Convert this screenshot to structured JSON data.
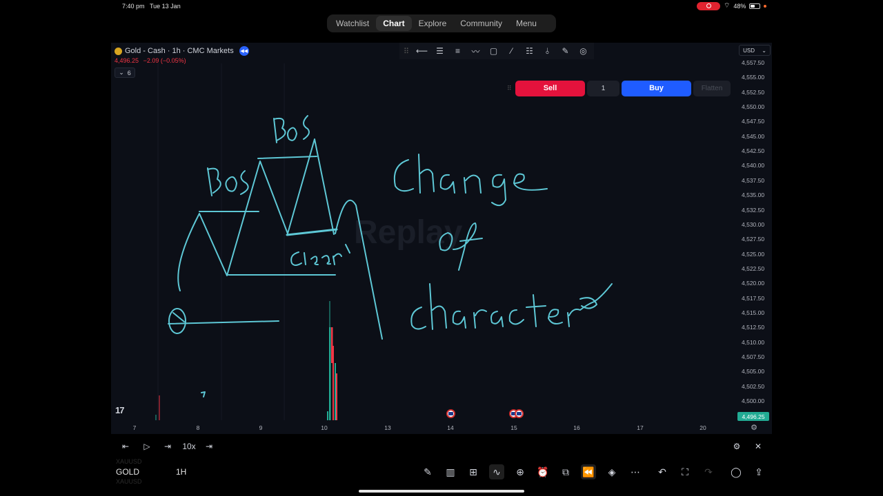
{
  "status_bar": {
    "time": "7:40 pm",
    "date": "Tue 13 Jan",
    "battery": "48%",
    "battery_level": 0.48
  },
  "top_tabs": [
    {
      "label": "Watchlist",
      "active": false
    },
    {
      "label": "Chart",
      "active": true
    },
    {
      "label": "Explore",
      "active": false
    },
    {
      "label": "Community",
      "active": false
    },
    {
      "label": "Menu",
      "active": false
    }
  ],
  "chart": {
    "symbol_title": "Gold - Cash · 1h · CMC Markets",
    "price": "4,496.25",
    "change": "−2.09 (−0.05%)",
    "indicators_count": "6",
    "currency": "USD",
    "watermark": "Replay",
    "current_price_label": "4,496.25",
    "price_ticks": [
      "4,557.50",
      "4,555.00",
      "4,552.50",
      "4,550.00",
      "4,547.50",
      "4,545.00",
      "4,542.50",
      "4,540.00",
      "4,537.50",
      "4,535.00",
      "4,532.50",
      "4,530.00",
      "4,527.50",
      "4,525.00",
      "4,522.50",
      "4,520.00",
      "4,517.50",
      "4,515.00",
      "4,512.50",
      "4,510.00",
      "4,507.50",
      "4,505.00",
      "4,502.50",
      "4,500.00"
    ],
    "time_ticks": [
      "7",
      "8",
      "9",
      "10",
      "13",
      "14",
      "15",
      "16",
      "17",
      "20"
    ],
    "colors": {
      "up": "#22ab94",
      "down": "#f23645",
      "ink": "#5ec8d6",
      "buy": "#1f5cff",
      "sell": "#e4123c"
    }
  },
  "drawing_tools": [
    "horizontal-line-icon",
    "parallel-channel-icon",
    "regression-icon",
    "path-icon",
    "rectangle-icon",
    "trend-line-icon",
    "fib-icon",
    "pitchfork-icon",
    "brush-icon",
    "target-icon"
  ],
  "trade": {
    "sell_label": "Sell",
    "quantity": "1",
    "buy_label": "Buy",
    "flatten_label": "Flatten"
  },
  "replay": {
    "speed": "10x"
  },
  "bottom": {
    "symbol": "GOLD",
    "timeframe": "1H",
    "ghost_top": "XAUUSD",
    "ghost_bottom": "XAUUSD"
  },
  "annotations": {
    "bos_1": "BOS",
    "bos_2": "BOS",
    "choch_1": "Change",
    "choch_2": "of",
    "choch_3": "character",
    "clear": "clear"
  }
}
